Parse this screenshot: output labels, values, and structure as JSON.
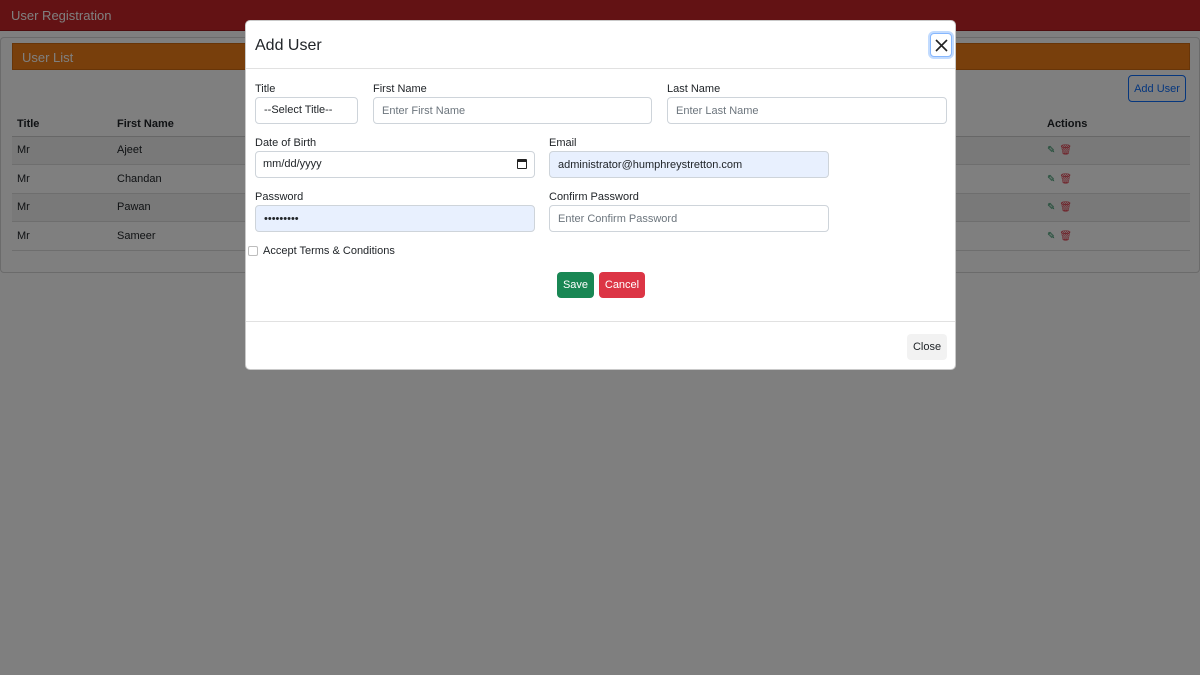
{
  "app": {
    "title": "User Registration"
  },
  "user_list": {
    "header": "User List",
    "add_button": "Add User",
    "columns": [
      "Title",
      "First Name",
      "Actions"
    ],
    "rows": [
      {
        "title": "Mr",
        "first_name": "Ajeet"
      },
      {
        "title": "Mr",
        "first_name": "Chandan"
      },
      {
        "title": "Mr",
        "first_name": "Pawan"
      },
      {
        "title": "Mr",
        "first_name": "Sameer"
      }
    ],
    "action_icons": [
      "edit-icon",
      "delete-icon"
    ]
  },
  "modal": {
    "title": "Add User",
    "close_icon": "close-icon",
    "fields": {
      "title": {
        "label": "Title",
        "selected": "--Select Title--"
      },
      "first_name": {
        "label": "First Name",
        "placeholder": "Enter First Name",
        "value": ""
      },
      "last_name": {
        "label": "Last Name",
        "placeholder": "Enter Last Name",
        "value": ""
      },
      "dob": {
        "label": "Date of Birth",
        "value": "mm/dd/yyyy"
      },
      "email": {
        "label": "Email",
        "value": "administrator@humphreystretton.com"
      },
      "password": {
        "label": "Password",
        "value": "•••••••••"
      },
      "confirm_password": {
        "label": "Confirm Password",
        "placeholder": "Enter Confirm Password",
        "value": ""
      }
    },
    "terms_label": "Accept Terms & Conditions",
    "save_label": "Save",
    "cancel_label": "Cancel",
    "close_label": "Close"
  },
  "colors": {
    "topbar": "#c72528",
    "list_header": "#f07e18",
    "save": "#198754",
    "cancel": "#dc3545",
    "primary": "#0d6efd",
    "autofill": "#e8f0fe"
  }
}
